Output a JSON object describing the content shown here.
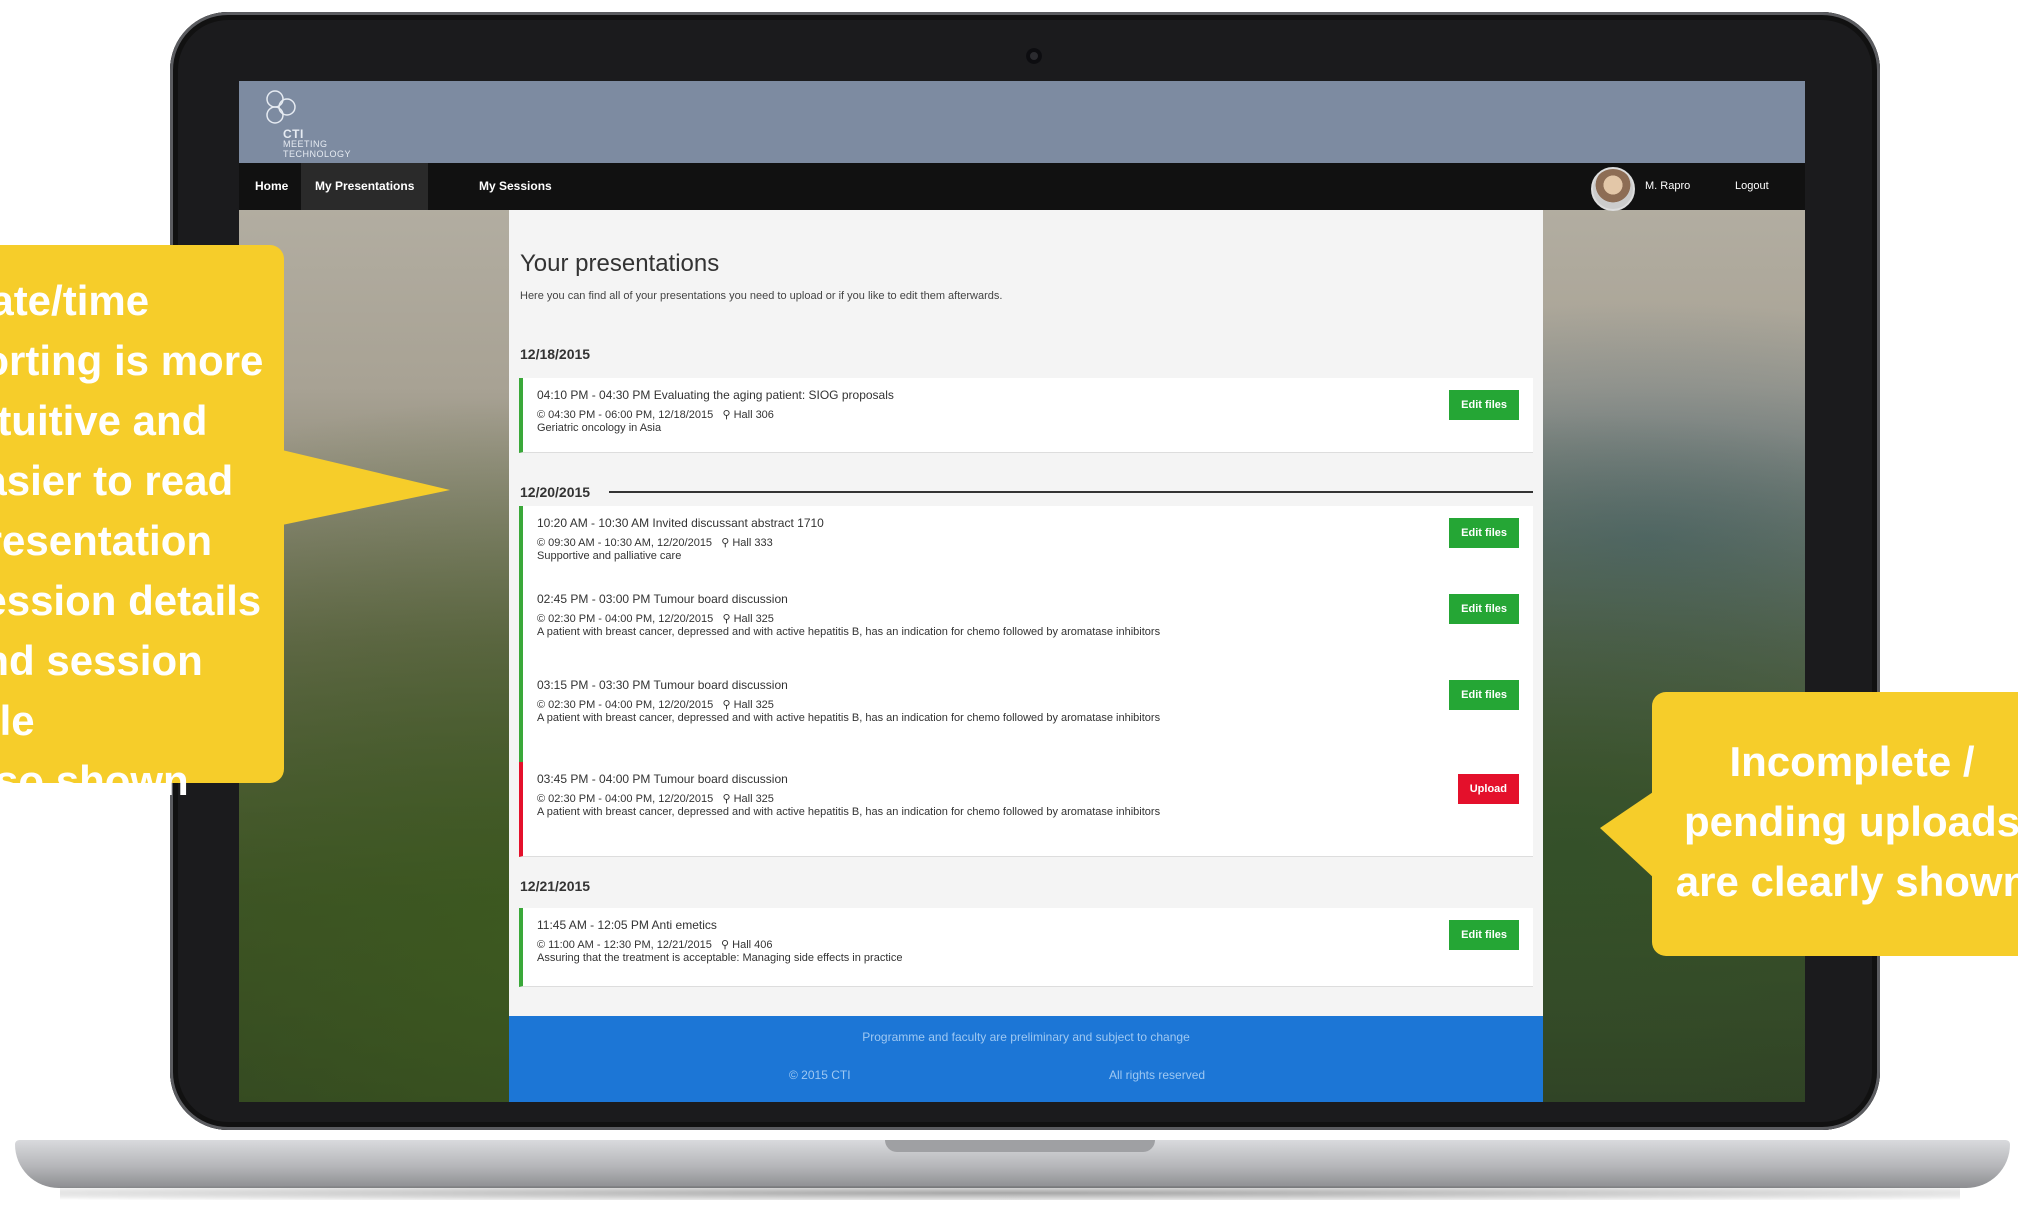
{
  "site": {
    "logo_line1": "CTI",
    "logo_line2": "MEETING",
    "logo_line3": "TECHNOLOGY"
  },
  "nav": {
    "home": "Home",
    "my_presentations": "My Presentations",
    "my_sessions": "My Sessions",
    "user_name": "M. Rapro",
    "logout": "Logout"
  },
  "page": {
    "title": "Your presentations",
    "subtitle": "Here you can find all of your presentations you need to upload or if you like to edit them afterwards."
  },
  "groups": [
    {
      "date": "12/18/2015",
      "items": [
        {
          "title": "04:10 PM - 04:30 PM Evaluating the aging patient: SIOG proposals",
          "session": "© 04:30 PM - 06:00 PM, 12/18/2015",
          "room": "Hall 306",
          "topic": "Geriatric oncology in Asia",
          "button": "Edit files",
          "status": "complete"
        }
      ]
    },
    {
      "date": "12/20/2015",
      "items": [
        {
          "title": "10:20 AM - 10:30 AM Invited discussant abstract 1710",
          "session": "© 09:30 AM - 10:30 AM, 12/20/2015",
          "room": "Hall 333",
          "topic": "Supportive and palliative care",
          "button": "Edit files",
          "status": "complete"
        },
        {
          "title": "02:45 PM - 03:00 PM Tumour board discussion",
          "session": "© 02:30 PM - 04:00 PM, 12/20/2015",
          "room": "Hall 325",
          "topic": "A patient with breast cancer, depressed and with active hepatitis B, has an indication for chemo followed by aromatase inhibitors",
          "button": "Edit files",
          "status": "complete"
        },
        {
          "title": "03:15 PM - 03:30 PM Tumour board discussion",
          "session": "© 02:30 PM - 04:00 PM, 12/20/2015",
          "room": "Hall 325",
          "topic": "A patient with breast cancer, depressed and with active hepatitis B, has an indication for chemo followed by aromatase inhibitors",
          "button": "Edit files",
          "status": "complete"
        },
        {
          "title": "03:45 PM - 04:00 PM Tumour board discussion",
          "session": "© 02:30 PM - 04:00 PM, 12/20/2015",
          "room": "Hall 325",
          "topic": "A patient with breast cancer, depressed and with active hepatitis B, has an indication for chemo followed by aromatase inhibitors",
          "button": "Upload",
          "status": "pending"
        }
      ]
    },
    {
      "date": "12/21/2015",
      "items": [
        {
          "title": "11:45 AM - 12:05 PM Anti emetics",
          "session": "© 11:00 AM - 12:30 PM, 12/21/2015",
          "room": "Hall 406",
          "topic": "Assuring that the treatment is acceptable: Managing side effects in practice",
          "button": "Edit files",
          "status": "complete"
        }
      ]
    }
  ],
  "footer": {
    "note": "Programme and faculty are preliminary and subject to change",
    "copyright": "© 2015 CTI",
    "rights": "All rights reserved"
  },
  "callouts": {
    "left_lines": [
      "Date/time",
      "sorting is more",
      "intuitive and",
      "easier to read",
      "presentation",
      "session details",
      "and session title",
      "also shown"
    ],
    "right_lines": [
      "Incomplete /",
      "pending uploads",
      "are clearly shown"
    ]
  },
  "colors": {
    "complete": "#25a635",
    "pending": "#e4102b",
    "callout": "#f6cd2a",
    "header": "#7d8ba1",
    "footer": "#1c76d6"
  }
}
